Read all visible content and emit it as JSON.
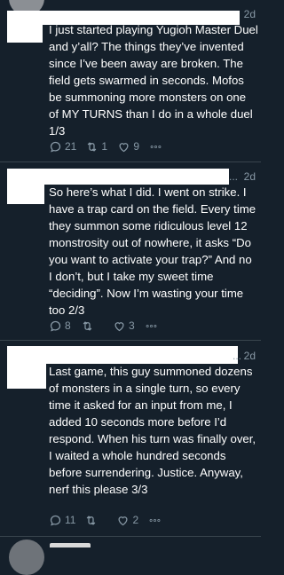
{
  "tweets": [
    {
      "time": "2d",
      "text": "I just started playing Yugioh Master Duel and y’all? The things they’ve invented since I’ve been away are broken. The field gets swarmed in seconds. Mofos be summoning more monsters on one of MY TURNS than I do in a whole duel 1/3",
      "replies": "21",
      "retweets": "1",
      "likes": "9"
    },
    {
      "time": "2d",
      "dots": "...",
      "text": "So here’s what I did. I went on strike. I have a trap card on the field. Every time they summon some ridiculous level 12 monstrosity out of nowhere, it asks “Do you want to activate your trap?” And no I don’t, but I take my sweet time “deciding”. Now I’m wasting your time too 2/3",
      "replies": "8",
      "retweets": "",
      "likes": "3"
    },
    {
      "time": "2d",
      "dots": "...",
      "text": "Last game, this guy summoned dozens of monsters in a single turn, so every time it asked for an input from me, I added 10 seconds more before I’d respond. When his turn was finally over, I waited a whole hundred seconds before surrendering. Justice. Anyway, nerf this please 3/3",
      "replies": "11",
      "retweets": "",
      "likes": "2"
    }
  ],
  "icons": {
    "reply": "reply-icon",
    "retweet": "retweet-icon",
    "like": "heart-icon",
    "more": "more-icon"
  }
}
